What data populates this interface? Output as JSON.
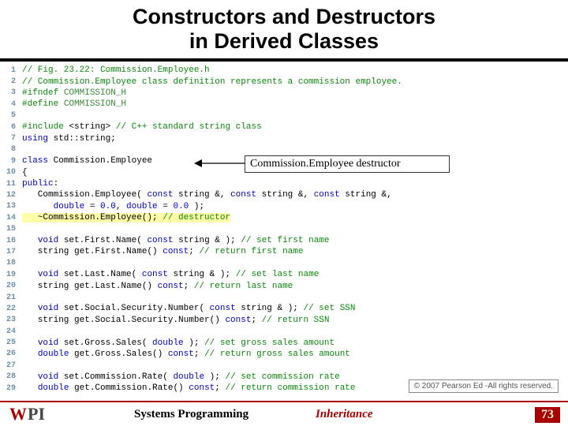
{
  "title": "Constructors and Destructors\nin Derived Classes",
  "callout": "Commission.Employee destructor",
  "copyright": "© 2007 Pearson Ed -All rights reserved.",
  "footer": {
    "logo_w": "W",
    "logo_pi": "PI",
    "center": "Systems Programming",
    "topic": "Inheritance",
    "page": "73"
  },
  "code": [
    {
      "n": "1",
      "segs": [
        {
          "c": "cmt",
          "t": "// Fig. 23.22: Commission.Employee.h"
        }
      ]
    },
    {
      "n": "2",
      "segs": [
        {
          "c": "cmt",
          "t": "// Commission.Employee class definition represents a commission employee."
        }
      ]
    },
    {
      "n": "3",
      "segs": [
        {
          "c": "pp",
          "t": "#ifndef "
        },
        {
          "c": "mac",
          "t": "COMMISSION_H"
        }
      ]
    },
    {
      "n": "4",
      "segs": [
        {
          "c": "pp",
          "t": "#define "
        },
        {
          "c": "mac",
          "t": "COMMISSION_H"
        }
      ]
    },
    {
      "n": "5",
      "segs": []
    },
    {
      "n": "6",
      "segs": [
        {
          "c": "pp",
          "t": "#include "
        },
        {
          "c": "id",
          "t": "<string> "
        },
        {
          "c": "cmt",
          "t": "// C++ standard string class"
        }
      ]
    },
    {
      "n": "7",
      "segs": [
        {
          "c": "kw",
          "t": "using "
        },
        {
          "c": "id",
          "t": "std::string;"
        }
      ]
    },
    {
      "n": "8",
      "segs": []
    },
    {
      "n": "9",
      "segs": [
        {
          "c": "kw",
          "t": "class "
        },
        {
          "c": "id",
          "t": "Commission.Employee"
        }
      ]
    },
    {
      "n": "10",
      "segs": [
        {
          "c": "id",
          "t": "{"
        }
      ]
    },
    {
      "n": "11",
      "segs": [
        {
          "c": "kw",
          "t": "public"
        },
        {
          "c": "id",
          "t": ":"
        }
      ]
    },
    {
      "n": "12",
      "segs": [
        {
          "c": "id",
          "t": "   Commission.Employee( "
        },
        {
          "c": "kw",
          "t": "const "
        },
        {
          "c": "id",
          "t": "string &, "
        },
        {
          "c": "kw",
          "t": "const "
        },
        {
          "c": "id",
          "t": "string &, "
        },
        {
          "c": "kw",
          "t": "const "
        },
        {
          "c": "id",
          "t": "string &,"
        }
      ]
    },
    {
      "n": "13",
      "segs": [
        {
          "c": "id",
          "t": "      "
        },
        {
          "c": "kw",
          "t": "double"
        },
        {
          "c": "id",
          "t": " = "
        },
        {
          "c": "kw",
          "t": "0.0"
        },
        {
          "c": "id",
          "t": ", "
        },
        {
          "c": "kw",
          "t": "double"
        },
        {
          "c": "id",
          "t": " = "
        },
        {
          "c": "kw",
          "t": "0.0"
        },
        {
          "c": "id",
          "t": " );"
        }
      ]
    },
    {
      "n": "14",
      "hl": true,
      "segs": [
        {
          "c": "id",
          "t": "   ~Commission.Employee(); "
        },
        {
          "c": "cmt",
          "t": "// destructor"
        }
      ]
    },
    {
      "n": "15",
      "segs": []
    },
    {
      "n": "16",
      "segs": [
        {
          "c": "id",
          "t": "   "
        },
        {
          "c": "kw",
          "t": "void "
        },
        {
          "c": "id",
          "t": "set.First.Name( "
        },
        {
          "c": "kw",
          "t": "const "
        },
        {
          "c": "id",
          "t": "string & ); "
        },
        {
          "c": "cmt",
          "t": "// set first name"
        }
      ]
    },
    {
      "n": "17",
      "segs": [
        {
          "c": "id",
          "t": "   string get.First.Name() "
        },
        {
          "c": "kw",
          "t": "const"
        },
        {
          "c": "id",
          "t": "; "
        },
        {
          "c": "cmt",
          "t": "// return first name"
        }
      ]
    },
    {
      "n": "18",
      "segs": []
    },
    {
      "n": "19",
      "segs": [
        {
          "c": "id",
          "t": "   "
        },
        {
          "c": "kw",
          "t": "void "
        },
        {
          "c": "id",
          "t": "set.Last.Name( "
        },
        {
          "c": "kw",
          "t": "const "
        },
        {
          "c": "id",
          "t": "string & ); "
        },
        {
          "c": "cmt",
          "t": "// set last name"
        }
      ]
    },
    {
      "n": "20",
      "segs": [
        {
          "c": "id",
          "t": "   string get.Last.Name() "
        },
        {
          "c": "kw",
          "t": "const"
        },
        {
          "c": "id",
          "t": "; "
        },
        {
          "c": "cmt",
          "t": "// return last name"
        }
      ]
    },
    {
      "n": "21",
      "segs": []
    },
    {
      "n": "22",
      "segs": [
        {
          "c": "id",
          "t": "   "
        },
        {
          "c": "kw",
          "t": "void "
        },
        {
          "c": "id",
          "t": "set.Social.Security.Number( "
        },
        {
          "c": "kw",
          "t": "const "
        },
        {
          "c": "id",
          "t": "string & ); "
        },
        {
          "c": "cmt",
          "t": "// set SSN"
        }
      ]
    },
    {
      "n": "23",
      "segs": [
        {
          "c": "id",
          "t": "   string get.Social.Security.Number() "
        },
        {
          "c": "kw",
          "t": "const"
        },
        {
          "c": "id",
          "t": "; "
        },
        {
          "c": "cmt",
          "t": "// return SSN"
        }
      ]
    },
    {
      "n": "24",
      "segs": []
    },
    {
      "n": "25",
      "segs": [
        {
          "c": "id",
          "t": "   "
        },
        {
          "c": "kw",
          "t": "void "
        },
        {
          "c": "id",
          "t": "set.Gross.Sales( "
        },
        {
          "c": "kw",
          "t": "double "
        },
        {
          "c": "id",
          "t": "); "
        },
        {
          "c": "cmt",
          "t": "// set gross sales amount"
        }
      ]
    },
    {
      "n": "26",
      "segs": [
        {
          "c": "id",
          "t": "   "
        },
        {
          "c": "kw",
          "t": "double "
        },
        {
          "c": "id",
          "t": "get.Gross.Sales() "
        },
        {
          "c": "kw",
          "t": "const"
        },
        {
          "c": "id",
          "t": "; "
        },
        {
          "c": "cmt",
          "t": "// return gross sales amount"
        }
      ]
    },
    {
      "n": "27",
      "segs": []
    },
    {
      "n": "28",
      "segs": [
        {
          "c": "id",
          "t": "   "
        },
        {
          "c": "kw",
          "t": "void "
        },
        {
          "c": "id",
          "t": "set.Commission.Rate( "
        },
        {
          "c": "kw",
          "t": "double "
        },
        {
          "c": "id",
          "t": "); "
        },
        {
          "c": "cmt",
          "t": "// set commission rate"
        }
      ]
    },
    {
      "n": "29",
      "segs": [
        {
          "c": "id",
          "t": "   "
        },
        {
          "c": "kw",
          "t": "double "
        },
        {
          "c": "id",
          "t": "get.Commission.Rate() "
        },
        {
          "c": "kw",
          "t": "const"
        },
        {
          "c": "id",
          "t": "; "
        },
        {
          "c": "cmt",
          "t": "// return commission rate"
        }
      ]
    }
  ]
}
